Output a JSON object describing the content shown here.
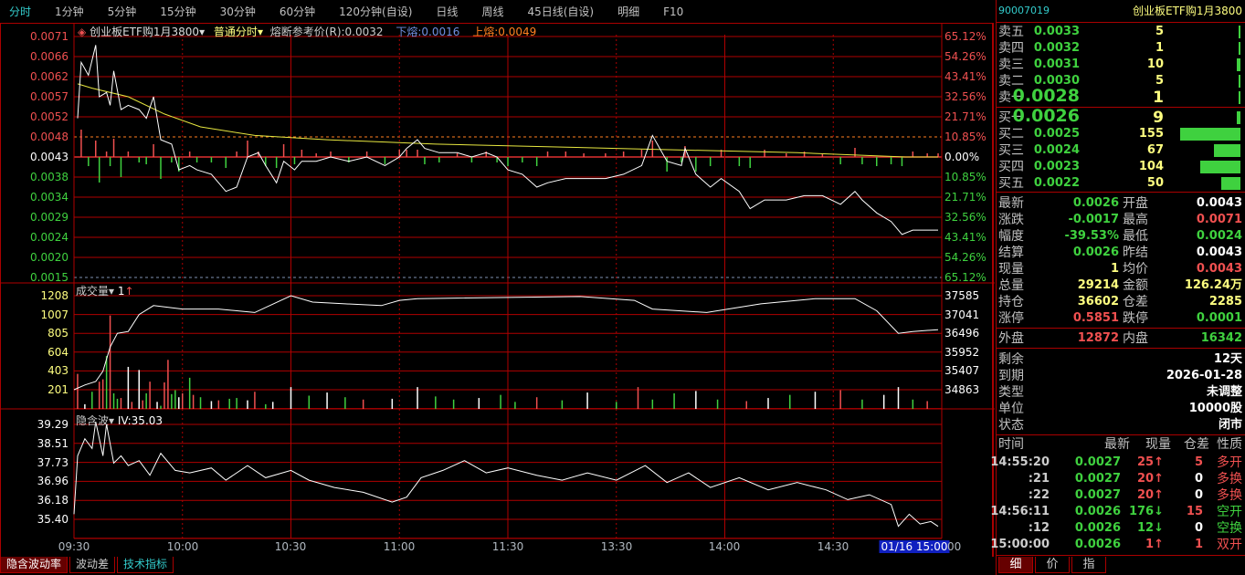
{
  "tabs": [
    "分时",
    "1分钟",
    "5分钟",
    "15分钟",
    "30分钟",
    "60分钟",
    "120分钟(自设)",
    "日线",
    "周线",
    "45日线(自设)",
    "明细",
    "F10"
  ],
  "chart_header": {
    "name": "创业板ETF购1月3800",
    "mode": "普通分时",
    "ref": "熔断参考价(R):0.0032",
    "lower": "下熔:0.0016",
    "upper": "上熔:0.0049"
  },
  "price_axis": {
    "left": [
      "0.0071",
      "0.0066",
      "0.0062",
      "0.0057",
      "0.0052",
      "0.0048",
      "0.0043",
      "0.0038",
      "0.0034",
      "0.0029",
      "0.0024",
      "0.0020",
      "0.0015"
    ],
    "right": [
      "65.12%",
      "54.26%",
      "43.41%",
      "32.56%",
      "21.71%",
      "10.85%",
      "0.00%",
      "10.85%",
      "21.71%",
      "32.56%",
      "43.41%",
      "54.26%",
      "65.12%"
    ]
  },
  "volume_header": {
    "label": "成交量",
    "value": "1"
  },
  "volume_axis": {
    "left": [
      "1208",
      "1007",
      "805",
      "604",
      "403",
      "201"
    ],
    "right": [
      "37585",
      "37041",
      "36496",
      "35952",
      "35407",
      "34863"
    ]
  },
  "iv_header": {
    "label": "隐含波",
    "value": "IV:35.03"
  },
  "iv_axis": [
    "39.29",
    "38.51",
    "37.73",
    "36.96",
    "36.18",
    "35.40"
  ],
  "time_axis": [
    "09:30",
    "10:00",
    "10:30",
    "11:00",
    "11:30",
    "13:30",
    "14:00",
    "14:30",
    "01/16 15:00",
    "00"
  ],
  "bottom_tabs": [
    "隐含波动率",
    "波动差",
    "技术指标"
  ],
  "colors": {
    "up": "#f05050",
    "down": "#3fd13f",
    "grid": "#b00000",
    "price": "#ffffff",
    "avg": "#e8e840"
  },
  "chart_data": {
    "type": "line",
    "minutes_total": 240,
    "prev_settle": 0.0043,
    "price": [
      [
        1,
        0.0052
      ],
      [
        2,
        0.0065
      ],
      [
        4,
        0.0062
      ],
      [
        6,
        0.0069
      ],
      [
        7,
        0.0057
      ],
      [
        9,
        0.0058
      ],
      [
        10,
        0.0055
      ],
      [
        11,
        0.0063
      ],
      [
        13,
        0.0054
      ],
      [
        15,
        0.0055
      ],
      [
        18,
        0.0054
      ],
      [
        20,
        0.0052
      ],
      [
        22,
        0.0057
      ],
      [
        24,
        0.0047
      ],
      [
        27,
        0.0046
      ],
      [
        29,
        0.004
      ],
      [
        32,
        0.0041
      ],
      [
        34,
        0.004
      ],
      [
        38,
        0.0039
      ],
      [
        42,
        0.0035
      ],
      [
        45,
        0.0036
      ],
      [
        48,
        0.0043
      ],
      [
        51,
        0.0044
      ],
      [
        53,
        0.0041
      ],
      [
        56,
        0.0037
      ],
      [
        58,
        0.0042
      ],
      [
        61,
        0.004
      ],
      [
        63,
        0.0042
      ],
      [
        67,
        0.0042
      ],
      [
        71,
        0.0043
      ],
      [
        76,
        0.0042
      ],
      [
        81,
        0.0043
      ],
      [
        86,
        0.0041
      ],
      [
        90,
        0.0043
      ],
      [
        92,
        0.0045
      ],
      [
        95,
        0.0047
      ],
      [
        97,
        0.0045
      ],
      [
        101,
        0.0044
      ],
      [
        106,
        0.0044
      ],
      [
        110,
        0.0043
      ],
      [
        114,
        0.0044
      ],
      [
        117,
        0.0043
      ],
      [
        120,
        0.004
      ],
      [
        124,
        0.0039
      ],
      [
        128,
        0.0036
      ],
      [
        131,
        0.0037
      ],
      [
        136,
        0.0038
      ],
      [
        141,
        0.0038
      ],
      [
        147,
        0.0038
      ],
      [
        152,
        0.0039
      ],
      [
        157,
        0.0041
      ],
      [
        160,
        0.0048
      ],
      [
        164,
        0.0042
      ],
      [
        168,
        0.0041
      ],
      [
        169,
        0.0045
      ],
      [
        172,
        0.0039
      ],
      [
        176,
        0.0036
      ],
      [
        179,
        0.0038
      ],
      [
        184,
        0.0035
      ],
      [
        187,
        0.0031
      ],
      [
        191,
        0.0033
      ],
      [
        197,
        0.0033
      ],
      [
        202,
        0.0034
      ],
      [
        207,
        0.0034
      ],
      [
        212,
        0.0032
      ],
      [
        216,
        0.0035
      ],
      [
        218,
        0.0033
      ],
      [
        222,
        0.003
      ],
      [
        226,
        0.0028
      ],
      [
        229,
        0.0025
      ],
      [
        232,
        0.0026
      ],
      [
        236,
        0.0026
      ],
      [
        239,
        0.0026
      ]
    ],
    "avg_price": [
      [
        1,
        0.006
      ],
      [
        5,
        0.0059
      ],
      [
        15,
        0.0057
      ],
      [
        25,
        0.0053
      ],
      [
        35,
        0.005
      ],
      [
        50,
        0.0048
      ],
      [
        70,
        0.0047
      ],
      [
        100,
        0.0046
      ],
      [
        150,
        0.0045
      ],
      [
        200,
        0.0044
      ],
      [
        230,
        0.0043
      ],
      [
        239,
        0.0043
      ]
    ],
    "volume": [
      [
        1,
        450,
        "u"
      ],
      [
        3,
        60,
        "w"
      ],
      [
        5,
        220,
        "d"
      ],
      [
        7,
        350,
        "u"
      ],
      [
        8,
        380,
        "u"
      ],
      [
        9,
        680,
        "d"
      ],
      [
        10,
        1200,
        "u"
      ],
      [
        11,
        200,
        "d"
      ],
      [
        12,
        130,
        "d"
      ],
      [
        13,
        140,
        "u"
      ],
      [
        15,
        540,
        "w"
      ],
      [
        16,
        90,
        "u"
      ],
      [
        18,
        500,
        "w"
      ],
      [
        19,
        110,
        "u"
      ],
      [
        20,
        200,
        "d"
      ],
      [
        21,
        350,
        "u"
      ],
      [
        23,
        90,
        "w"
      ],
      [
        24,
        40,
        "d"
      ],
      [
        25,
        340,
        "u"
      ],
      [
        26,
        630,
        "u"
      ],
      [
        27,
        190,
        "d"
      ],
      [
        28,
        240,
        "d"
      ],
      [
        29,
        150,
        "w"
      ],
      [
        30,
        200,
        "u"
      ],
      [
        32,
        400,
        "d"
      ],
      [
        33,
        180,
        "u"
      ],
      [
        35,
        150,
        "d"
      ],
      [
        38,
        100,
        "w"
      ],
      [
        40,
        110,
        "u"
      ],
      [
        43,
        130,
        "d"
      ],
      [
        45,
        140,
        "d"
      ],
      [
        48,
        110,
        "w"
      ],
      [
        50,
        220,
        "u"
      ],
      [
        53,
        60,
        "d"
      ],
      [
        55,
        90,
        "w"
      ],
      [
        60,
        280,
        "w"
      ],
      [
        65,
        170,
        "d"
      ],
      [
        70,
        210,
        "w"
      ],
      [
        75,
        150,
        "d"
      ],
      [
        80,
        120,
        "u"
      ],
      [
        88,
        130,
        "w"
      ],
      [
        95,
        280,
        "w"
      ],
      [
        100,
        160,
        "d"
      ],
      [
        105,
        120,
        "d"
      ],
      [
        112,
        140,
        "w"
      ],
      [
        118,
        180,
        "d"
      ],
      [
        122,
        90,
        "d"
      ],
      [
        128,
        150,
        "u"
      ],
      [
        135,
        110,
        "d"
      ],
      [
        142,
        210,
        "w"
      ],
      [
        150,
        90,
        "d"
      ],
      [
        156,
        280,
        "u"
      ],
      [
        160,
        120,
        "d"
      ],
      [
        166,
        200,
        "d"
      ],
      [
        172,
        230,
        "w"
      ],
      [
        178,
        120,
        "d"
      ],
      [
        186,
        100,
        "u"
      ],
      [
        192,
        140,
        "w"
      ],
      [
        198,
        180,
        "d"
      ],
      [
        205,
        220,
        "w"
      ],
      [
        212,
        240,
        "u"
      ],
      [
        218,
        120,
        "d"
      ],
      [
        224,
        180,
        "w"
      ],
      [
        228,
        280,
        "w"
      ],
      [
        232,
        120,
        "d"
      ],
      [
        236,
        100,
        "u"
      ]
    ],
    "open_interest": [
      [
        0,
        34863
      ],
      [
        3,
        35000
      ],
      [
        6,
        35100
      ],
      [
        8,
        35400
      ],
      [
        10,
        36100
      ],
      [
        12,
        36496
      ],
      [
        15,
        36550
      ],
      [
        18,
        37041
      ],
      [
        22,
        37300
      ],
      [
        30,
        37200
      ],
      [
        40,
        37200
      ],
      [
        50,
        37100
      ],
      [
        60,
        37585
      ],
      [
        66,
        37400
      ],
      [
        75,
        37350
      ],
      [
        85,
        37300
      ],
      [
        90,
        37450
      ],
      [
        95,
        37500
      ],
      [
        140,
        37560
      ],
      [
        155,
        37450
      ],
      [
        160,
        37200
      ],
      [
        175,
        37100
      ],
      [
        190,
        37350
      ],
      [
        205,
        37500
      ],
      [
        216,
        37500
      ],
      [
        222,
        37150
      ],
      [
        228,
        36496
      ],
      [
        232,
        36550
      ],
      [
        239,
        36602
      ]
    ],
    "iv": [
      [
        0,
        35.6
      ],
      [
        1,
        38.0
      ],
      [
        3,
        38.7
      ],
      [
        5,
        38.3
      ],
      [
        6,
        39.4
      ],
      [
        8,
        38.0
      ],
      [
        9,
        39.3
      ],
      [
        11,
        37.7
      ],
      [
        13,
        38.0
      ],
      [
        15,
        37.6
      ],
      [
        18,
        37.8
      ],
      [
        21,
        37.2
      ],
      [
        24,
        38.1
      ],
      [
        28,
        37.4
      ],
      [
        32,
        37.3
      ],
      [
        38,
        37.5
      ],
      [
        42,
        37.0
      ],
      [
        48,
        37.6
      ],
      [
        53,
        37.1
      ],
      [
        60,
        37.4
      ],
      [
        65,
        37.0
      ],
      [
        72,
        36.7
      ],
      [
        80,
        36.5
      ],
      [
        88,
        36.1
      ],
      [
        92,
        36.3
      ],
      [
        96,
        37.1
      ],
      [
        102,
        37.4
      ],
      [
        108,
        37.8
      ],
      [
        114,
        37.3
      ],
      [
        120,
        37.5
      ],
      [
        128,
        37.2
      ],
      [
        135,
        37.0
      ],
      [
        142,
        37.3
      ],
      [
        150,
        37.0
      ],
      [
        158,
        37.6
      ],
      [
        164,
        36.9
      ],
      [
        170,
        37.3
      ],
      [
        176,
        36.7
      ],
      [
        184,
        37.1
      ],
      [
        192,
        36.6
      ],
      [
        200,
        36.9
      ],
      [
        208,
        36.6
      ],
      [
        214,
        36.2
      ],
      [
        220,
        36.4
      ],
      [
        226,
        36.0
      ],
      [
        228,
        35.1
      ],
      [
        231,
        35.6
      ],
      [
        234,
        35.2
      ],
      [
        237,
        35.3
      ],
      [
        239,
        35.1
      ]
    ],
    "price_range": [
      0.0015,
      0.0071
    ],
    "volume_range": [
      0,
      1208
    ],
    "oi_range": [
      34863,
      37585
    ],
    "iv_range": [
      34.62,
      39.29
    ]
  },
  "quote": {
    "code": "90007019",
    "name": "创业板ETF购1月3800",
    "asks": [
      {
        "label": "卖五",
        "price": "0.0033",
        "vol": "5",
        "bar": 5
      },
      {
        "label": "卖四",
        "price": "0.0032",
        "vol": "1",
        "bar": 1
      },
      {
        "label": "卖三",
        "price": "0.0031",
        "vol": "10",
        "bar": 10
      },
      {
        "label": "卖二",
        "price": "0.0030",
        "vol": "5",
        "bar": 5
      },
      {
        "label": "卖一",
        "price": "0.0028",
        "vol": "1",
        "bar": 1
      }
    ],
    "bids": [
      {
        "label": "买一",
        "price": "0.0026",
        "vol": "9",
        "bar": 9
      },
      {
        "label": "买二",
        "price": "0.0025",
        "vol": "155",
        "bar": 155
      },
      {
        "label": "买三",
        "price": "0.0024",
        "vol": "67",
        "bar": 67
      },
      {
        "label": "买四",
        "price": "0.0023",
        "vol": "104",
        "bar": 104
      },
      {
        "label": "买五",
        "price": "0.0022",
        "vol": "50",
        "bar": 50
      }
    ],
    "stats": [
      {
        "l1": "最新",
        "v1": "0.0026",
        "c1": "g",
        "l2": "开盘",
        "v2": "0.0043",
        "c2": "w"
      },
      {
        "l1": "涨跌",
        "v1": "-0.0017",
        "c1": "g",
        "l2": "最高",
        "v2": "0.0071",
        "c2": "r"
      },
      {
        "l1": "幅度",
        "v1": "-39.53%",
        "c1": "g",
        "l2": "最低",
        "v2": "0.0024",
        "c2": "g"
      },
      {
        "l1": "结算",
        "v1": "0.0026",
        "c1": "g",
        "l2": "昨结",
        "v2": "0.0043",
        "c2": "w"
      },
      {
        "l1": "现量",
        "v1": "1",
        "c1": "y",
        "l2": "均价",
        "v2": "0.0043",
        "c2": "r"
      },
      {
        "l1": "总量",
        "v1": "29214",
        "c1": "y",
        "l2": "金额",
        "v2": "126.24万",
        "c2": "y"
      },
      {
        "l1": "持仓",
        "v1": "36602",
        "c1": "y",
        "l2": "仓差",
        "v2": "2285",
        "c2": "y"
      },
      {
        "l1": "涨停",
        "v1": "0.5851",
        "c1": "r",
        "l2": "跌停",
        "v2": "0.0001",
        "c2": "g"
      }
    ],
    "outer": {
      "l1": "外盘",
      "v1": "12872",
      "l2": "内盘",
      "v2": "16342"
    },
    "info": [
      {
        "l": "剩余",
        "v": "12天"
      },
      {
        "l": "到期",
        "v": "2026-01-28"
      },
      {
        "l": "类型",
        "v": "未调整"
      },
      {
        "l": "单位",
        "v": "10000股"
      },
      {
        "l": "状态",
        "v": "闭市"
      }
    ],
    "ticks_header": [
      "时间",
      "最新",
      "现量",
      "仓差",
      "性质"
    ],
    "ticks": [
      {
        "t": "14:55:20",
        "p": "0.0027",
        "v": "25↑",
        "vc": "r",
        "d": "5",
        "dc": "r",
        "n": "多开",
        "nc": "r"
      },
      {
        "t": ":21",
        "p": "0.0027",
        "v": "20↑",
        "vc": "r",
        "d": "0",
        "dc": "w",
        "n": "多换",
        "nc": "r"
      },
      {
        "t": ":22",
        "p": "0.0027",
        "v": "20↑",
        "vc": "r",
        "d": "0",
        "dc": "w",
        "n": "多换",
        "nc": "r"
      },
      {
        "t": "14:56:11",
        "p": "0.0026",
        "v": "176↓",
        "vc": "g",
        "d": "15",
        "dc": "r",
        "n": "空开",
        "nc": "g"
      },
      {
        "t": ":12",
        "p": "0.0026",
        "v": "12↓",
        "vc": "g",
        "d": "0",
        "dc": "w",
        "n": "空换",
        "nc": "g"
      },
      {
        "t": "15:00:00",
        "p": "0.0026",
        "v": "1↑",
        "vc": "r",
        "d": "1",
        "dc": "r",
        "n": "双开",
        "nc": "r"
      }
    ],
    "tabs": [
      "细",
      "价",
      "指"
    ]
  }
}
